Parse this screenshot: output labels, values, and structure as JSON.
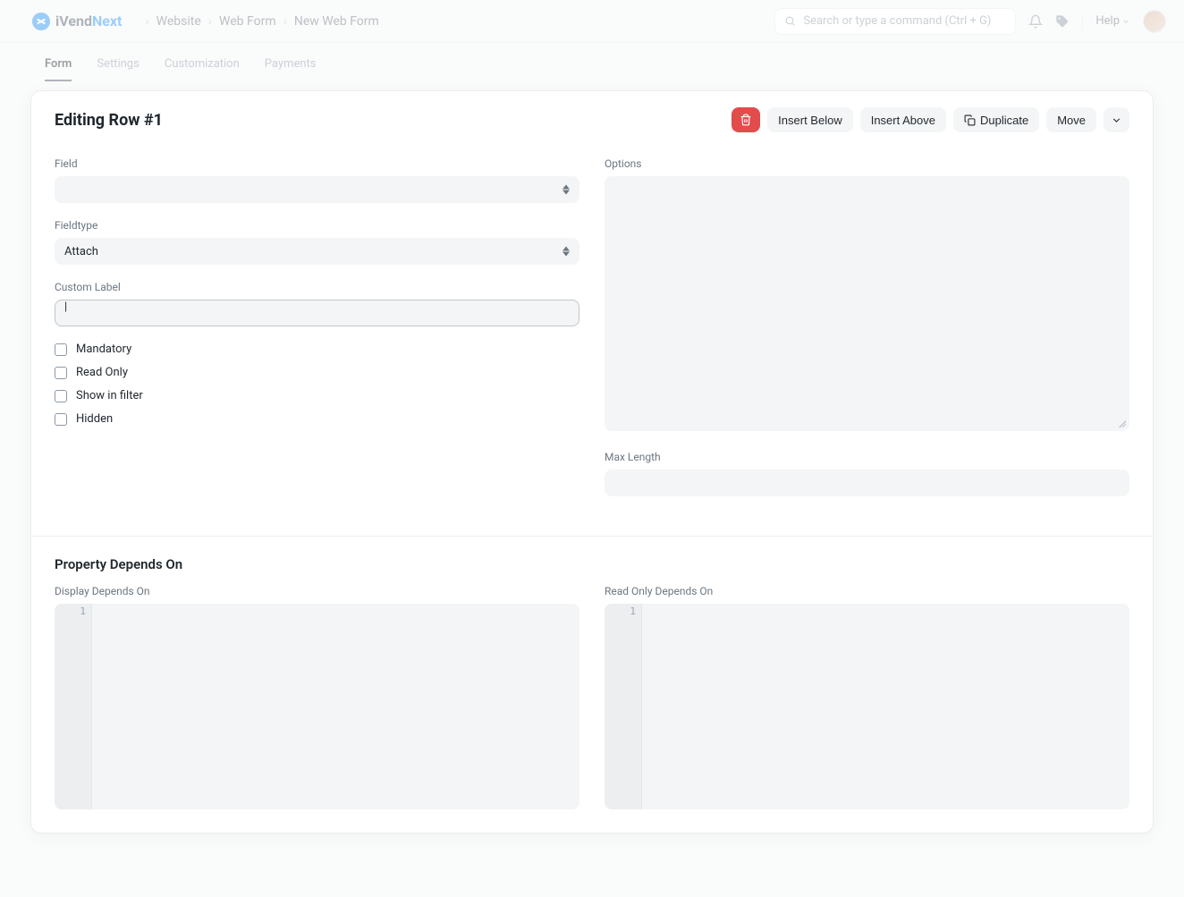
{
  "brand": {
    "part1": "iVend",
    "part2": "Next"
  },
  "breadcrumb": {
    "website": "Website",
    "webform": "Web Form",
    "current": "New Web Form"
  },
  "search": {
    "placeholder": "Search or type a command (Ctrl + G)"
  },
  "help": "Help",
  "tabs": {
    "form": "Form",
    "settings": "Settings",
    "customization": "Customization",
    "payments": "Payments"
  },
  "editor": {
    "title": "Editing Row #1",
    "actions": {
      "insert_below": "Insert Below",
      "insert_above": "Insert Above",
      "duplicate": "Duplicate",
      "move": "Move"
    }
  },
  "fields": {
    "field_label": "Field",
    "field_value": "",
    "fieldtype_label": "Fieldtype",
    "fieldtype_value": "Attach",
    "custom_label_label": "Custom Label",
    "custom_label_value": "",
    "mandatory": "Mandatory",
    "readonly": "Read Only",
    "showfilter": "Show in filter",
    "hidden": "Hidden",
    "options_label": "Options",
    "maxlength_label": "Max Length",
    "maxlength_value": ""
  },
  "depends": {
    "section_title": "Property Depends On",
    "display_label": "Display Depends On",
    "readonly_label": "Read Only Depends On",
    "line_num": "1"
  }
}
